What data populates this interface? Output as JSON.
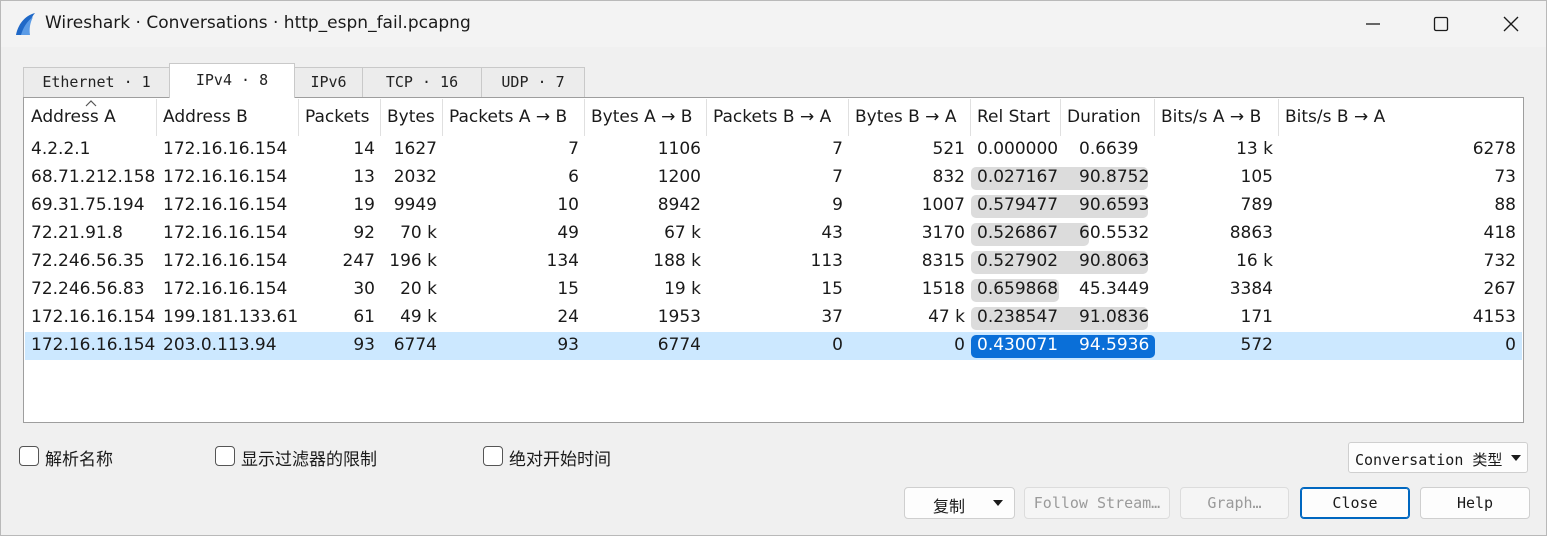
{
  "window": {
    "title": "Wireshark · Conversations · http_espn_fail.pcapng"
  },
  "tabs": [
    {
      "label": "Ethernet · 1",
      "active": false
    },
    {
      "label": "IPv4 · 8",
      "active": true
    },
    {
      "label": "IPv6",
      "active": false
    },
    {
      "label": "TCP · 16",
      "active": false
    },
    {
      "label": "UDP · 7",
      "active": false
    }
  ],
  "table": {
    "columns": [
      "Address A",
      "Address B",
      "Packets",
      "Bytes",
      "Packets A → B",
      "Bytes A → B",
      "Packets B → A",
      "Bytes B → A",
      "Rel Start",
      "Duration",
      "Bits/s A → B",
      "Bits/s B → A"
    ],
    "sorted_column": "Address A",
    "rows": [
      {
        "address_a": "4.2.2.1",
        "address_b": "172.16.16.154",
        "packets": "14",
        "bytes": "1627",
        "packets_ab": "7",
        "bytes_ab": "1106",
        "packets_ba": "7",
        "bytes_ba": "521",
        "rel_start": "0.000000",
        "duration": "0.6639",
        "bits_ab": "13 k",
        "bits_ba": "6278",
        "duration_fill": 0.01,
        "selected": false
      },
      {
        "address_a": "68.71.212.158",
        "address_b": "172.16.16.154",
        "packets": "13",
        "bytes": "2032",
        "packets_ab": "6",
        "bytes_ab": "1200",
        "packets_ba": "7",
        "bytes_ba": "832",
        "rel_start": "0.027167",
        "duration": "90.8752",
        "bits_ab": "105",
        "bits_ba": "73",
        "duration_fill": 0.96,
        "selected": false
      },
      {
        "address_a": "69.31.75.194",
        "address_b": "172.16.16.154",
        "packets": "19",
        "bytes": "9949",
        "packets_ab": "10",
        "bytes_ab": "8942",
        "packets_ba": "9",
        "bytes_ba": "1007",
        "rel_start": "0.579477",
        "duration": "90.6593",
        "bits_ab": "789",
        "bits_ba": "88",
        "duration_fill": 0.96,
        "selected": false
      },
      {
        "address_a": "72.21.91.8",
        "address_b": "172.16.16.154",
        "packets": "92",
        "bytes": "70 k",
        "packets_ab": "49",
        "bytes_ab": "67 k",
        "packets_ba": "43",
        "bytes_ba": "3170",
        "rel_start": "0.526867",
        "duration": "60.5532",
        "bits_ab": "8863",
        "bits_ba": "418",
        "duration_fill": 0.64,
        "selected": false
      },
      {
        "address_a": "72.246.56.35",
        "address_b": "172.16.16.154",
        "packets": "247",
        "bytes": "196 k",
        "packets_ab": "134",
        "bytes_ab": "188 k",
        "packets_ba": "113",
        "bytes_ba": "8315",
        "rel_start": "0.527902",
        "duration": "90.8063",
        "bits_ab": "16 k",
        "bits_ba": "732",
        "duration_fill": 0.96,
        "selected": false
      },
      {
        "address_a": "72.246.56.83",
        "address_b": "172.16.16.154",
        "packets": "30",
        "bytes": "20 k",
        "packets_ab": "15",
        "bytes_ab": "19 k",
        "packets_ba": "15",
        "bytes_ba": "1518",
        "rel_start": "0.659868",
        "duration": "45.3449",
        "bits_ab": "3384",
        "bits_ba": "267",
        "duration_fill": 0.48,
        "selected": false
      },
      {
        "address_a": "172.16.16.154",
        "address_b": "199.181.133.61",
        "packets": "61",
        "bytes": "49 k",
        "packets_ab": "24",
        "bytes_ab": "1953",
        "packets_ba": "37",
        "bytes_ba": "47 k",
        "rel_start": "0.238547",
        "duration": "91.0836",
        "bits_ab": "171",
        "bits_ba": "4153",
        "duration_fill": 0.96,
        "selected": false
      },
      {
        "address_a": "172.16.16.154",
        "address_b": "203.0.113.94",
        "packets": "93",
        "bytes": "6774",
        "packets_ab": "93",
        "bytes_ab": "6774",
        "packets_ba": "0",
        "bytes_ba": "0",
        "rel_start": "0.430071",
        "duration": "94.5936",
        "bits_ab": "572",
        "bits_ba": "0",
        "duration_fill": 1.0,
        "selected": true
      }
    ]
  },
  "options": {
    "resolve_names": "解析名称",
    "limit_to_filter": "显示过滤器的限制",
    "absolute_start_time": "绝对开始时间"
  },
  "conversation_type": "Conversation 类型",
  "buttons": {
    "copy": "复制",
    "follow_stream": "Follow Stream…",
    "graph": "Graph…",
    "close": "Close",
    "help": "Help"
  },
  "colors": {
    "selected_row": "#cce8ff",
    "duration_bar": "#dcdcdc",
    "duration_bar_selected": "#0a6fd8",
    "default_button_border": "#0067c0"
  },
  "icons": {
    "app": "wireshark-fin-icon",
    "sort": "sort-ascending-icon"
  }
}
